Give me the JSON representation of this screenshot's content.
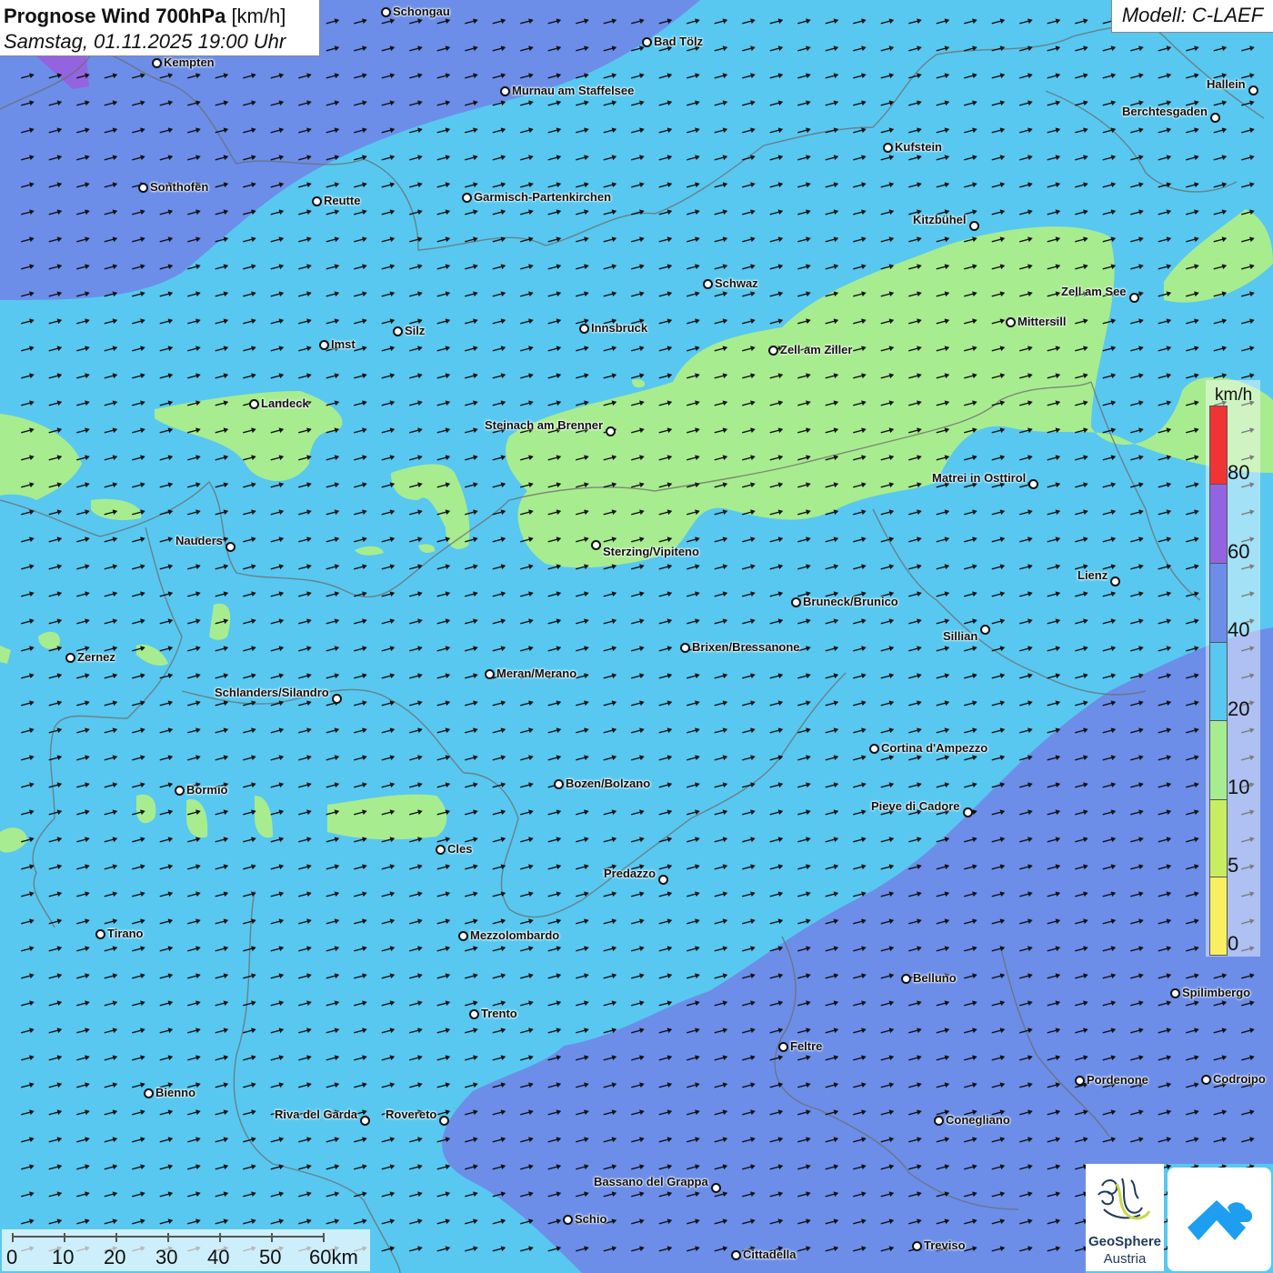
{
  "header": {
    "title_bold": "Prognose Wind 700hPa",
    "title_unit": "[km/h]",
    "subtitle": "Samstag, 01.11.2025 19:00 Uhr",
    "model": "Modell: C-LAEF"
  },
  "colors": {
    "wind_0_5": "#f8f060",
    "wind_5_10": "#c8ee60",
    "wind_10_20": "#a8ec90",
    "wind_20_40": "#58c8f0",
    "wind_40_60": "#6c8ee8",
    "wind_60_80": "#9464e0",
    "wind_80_plus": "#f03434"
  },
  "legend": {
    "unit": "km/h",
    "values": [
      "80",
      "60",
      "40",
      "20",
      "10",
      "5",
      "0"
    ]
  },
  "scale": {
    "labels": [
      "0",
      "10",
      "20",
      "30",
      "40",
      "50",
      "60km"
    ]
  },
  "logos": {
    "geosphere_name": "GeoSphere",
    "geosphere_sub": "Austria"
  },
  "wind_direction": "west-southwest to east-northeast",
  "cities": [
    {
      "name": "Schongau"
    },
    {
      "name": "Bad Tölz"
    },
    {
      "name": "Kempten"
    },
    {
      "name": "Murnau am Staffelsee"
    },
    {
      "name": "Hallein"
    },
    {
      "name": "Berchtesgaden"
    },
    {
      "name": "Kufstein"
    },
    {
      "name": "Sonthofen"
    },
    {
      "name": "Reutte"
    },
    {
      "name": "Garmisch-Partenkirchen"
    },
    {
      "name": "Kitzbühel"
    },
    {
      "name": "Schwaz"
    },
    {
      "name": "Zell am See"
    },
    {
      "name": "Mittersill"
    },
    {
      "name": "Innsbruck"
    },
    {
      "name": "Silz"
    },
    {
      "name": "Imst"
    },
    {
      "name": "Zell am Ziller"
    },
    {
      "name": "Landeck"
    },
    {
      "name": "Steinach am Brenner"
    },
    {
      "name": "Matrei in Osttirol"
    },
    {
      "name": "Nauders"
    },
    {
      "name": "Sterzing/Vipiteno"
    },
    {
      "name": "Lienz"
    },
    {
      "name": "Bruneck/Brunico"
    },
    {
      "name": "Sillian"
    },
    {
      "name": "Brixen/Bressanone"
    },
    {
      "name": "Zernez"
    },
    {
      "name": "Meran/Merano"
    },
    {
      "name": "Schlanders/Silandro"
    },
    {
      "name": "Cortina d'Ampezzo"
    },
    {
      "name": "Bozen/Bolzano"
    },
    {
      "name": "Bormio"
    },
    {
      "name": "Pieve di Cadore"
    },
    {
      "name": "Cles"
    },
    {
      "name": "Predazzo"
    },
    {
      "name": "Tirano"
    },
    {
      "name": "Mezzolombardo"
    },
    {
      "name": "Belluno"
    },
    {
      "name": "Spilimbergo"
    },
    {
      "name": "Trento"
    },
    {
      "name": "Feltre"
    },
    {
      "name": "Pordenone"
    },
    {
      "name": "Codroipo"
    },
    {
      "name": "Bienno"
    },
    {
      "name": "Riva del Garda"
    },
    {
      "name": "Rovereto"
    },
    {
      "name": "Conegliano"
    },
    {
      "name": "Bassano del Grappa"
    },
    {
      "name": "Schio"
    },
    {
      "name": "Treviso"
    },
    {
      "name": "Cittadella"
    }
  ]
}
